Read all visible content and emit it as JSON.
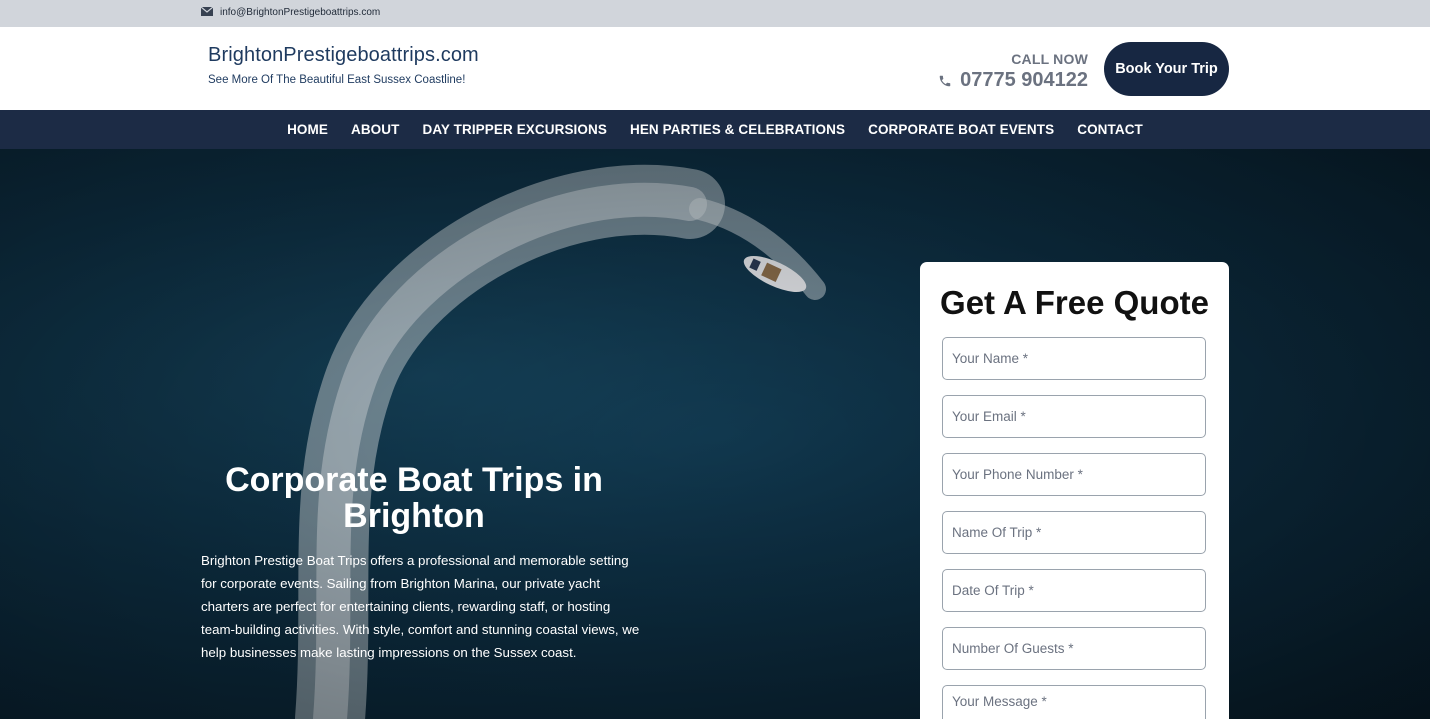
{
  "topbar": {
    "email": "info@BrightonPrestigeboattrips.com",
    "mail_icon": "envelope-icon"
  },
  "header": {
    "brand_title": "BrightonPrestigeboattrips.com",
    "brand_tagline": "See More Of The Beautiful East Sussex Coastline!",
    "call_now": "CALL NOW",
    "phone": "07775 904122",
    "phone_icon": "phone-icon",
    "book_button": "Book Your Trip"
  },
  "nav": {
    "items": [
      {
        "label": "HOME"
      },
      {
        "label": "ABOUT"
      },
      {
        "label": "DAY TRIPPER EXCURSIONS"
      },
      {
        "label": "HEN PARTIES & CELEBRATIONS"
      },
      {
        "label": "CORPORATE BOAT EVENTS"
      },
      {
        "label": "CONTACT"
      }
    ]
  },
  "hero": {
    "title": "Corporate Boat Trips in Brighton",
    "text": "Brighton Prestige Boat Trips offers a professional and memorable setting for corporate events. Sailing from Brighton Marina, our private yacht charters are perfect for entertaining clients, rewarding staff, or hosting team-building activities. With style, comfort and stunning coastal views, we help businesses make lasting impressions on the Sussex coast."
  },
  "quote": {
    "title": "Get A Free Quote",
    "fields": [
      {
        "placeholder": "Your Name *"
      },
      {
        "placeholder": "Your Email *"
      },
      {
        "placeholder": "Your Phone Number *"
      },
      {
        "placeholder": "Name Of Trip *"
      },
      {
        "placeholder": "Date Of Trip *"
      },
      {
        "placeholder": "Number Of Guests *"
      },
      {
        "placeholder": "Your Message *"
      }
    ]
  },
  "colors": {
    "navy": "#1c2b45",
    "button": "#172742",
    "topbar": "#d1d5db"
  }
}
